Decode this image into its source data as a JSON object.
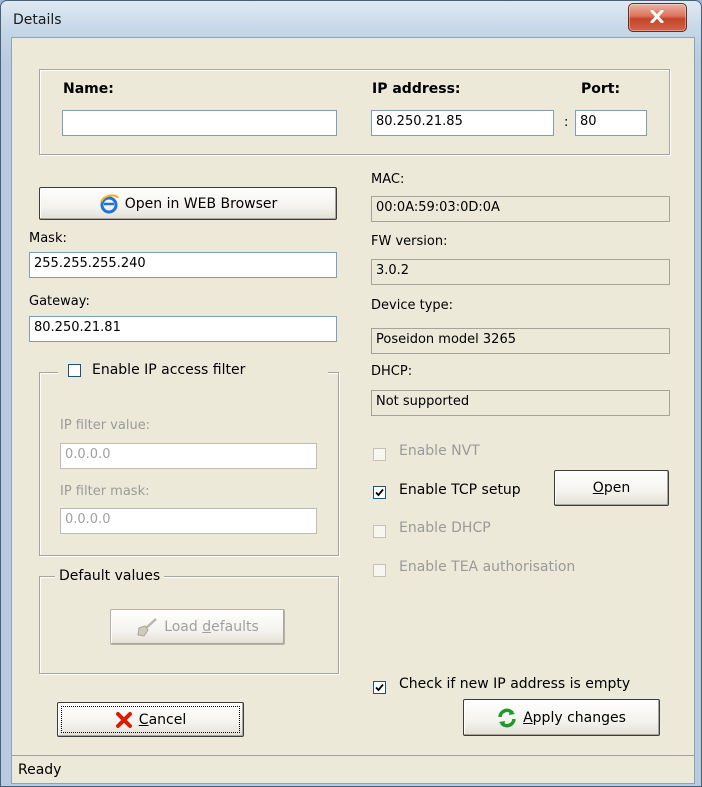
{
  "window": {
    "title": "Details"
  },
  "identity": {
    "name_label": "Name:",
    "name_value": "",
    "ip_label": "IP address:",
    "ip_value": "80.250.21.85",
    "port_label": "Port:",
    "port_sep": ":",
    "port_value": "80"
  },
  "left": {
    "open_browser_label": "Open in WEB Browser",
    "mask_label": "Mask:",
    "mask_value": "255.255.255.240",
    "gateway_label": "Gateway:",
    "gateway_value": "80.250.21.81",
    "ip_filter": {
      "enable_label": "Enable IP access filter",
      "enabled": false,
      "value_label": "IP filter value:",
      "value": "0.0.0.0",
      "mask_label": "IP filter mask:",
      "mask": "0.0.0.0"
    },
    "defaults": {
      "group_label": "Default values",
      "load_prefix": "Load ",
      "load_accel": "d",
      "load_suffix": "efaults"
    },
    "cancel": {
      "accel": "C",
      "rest": "ancel"
    }
  },
  "right": {
    "mac_label": "MAC:",
    "mac_value": "00:0A:59:03:0D:0A",
    "fw_label": "FW version:",
    "fw_value": "3.0.2",
    "device_label": "Device type:",
    "device_value": "Poseidon model 3265",
    "dhcp_label": "DHCP:",
    "dhcp_value": "Not supported",
    "enable_nvt": "Enable NVT",
    "enable_tcp": "Enable TCP setup",
    "open_button": {
      "accel": "O",
      "rest": "pen"
    },
    "enable_dhcp": "Enable DHCP",
    "enable_tea": "Enable TEA authorisation",
    "check_empty": "Check if new IP address is empty",
    "apply": {
      "accel": "A",
      "rest": "pply changes"
    }
  },
  "status": {
    "text": "Ready"
  },
  "icons": [
    "close-icon",
    "ie-icon",
    "broom-icon",
    "cancel-x-icon",
    "refresh-icon",
    "checkmark-icon"
  ],
  "colors": {
    "ie_blue": "#1e73d8",
    "cancel_red": "#d81e05",
    "apply_green": "#1d9a2a"
  }
}
